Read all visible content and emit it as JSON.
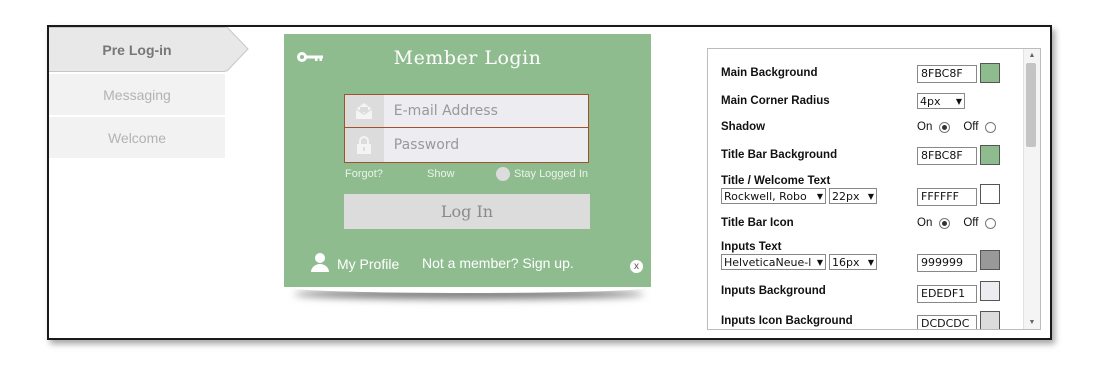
{
  "tabs": [
    {
      "label": "Pre Log-in",
      "active": true
    },
    {
      "label": "Messaging",
      "active": false
    },
    {
      "label": "Welcome",
      "active": false
    }
  ],
  "login": {
    "title": "Member Login",
    "email_placeholder": "E-mail Address",
    "password_placeholder": "Password",
    "forgot": "Forgot?",
    "show": "Show",
    "stay_logged_in": "Stay Logged In",
    "login_button": "Log In",
    "my_profile": "My Profile",
    "signup": "Not a member? Sign up.",
    "close": "x",
    "colors": {
      "background": "#8FBC8F",
      "input_border": "#A0522D",
      "input_bg": "#EDEDF1",
      "icon_bg": "#DCDCDC"
    },
    "icons": [
      "key-icon",
      "envelope-icon",
      "lock-icon",
      "user-icon",
      "close-icon"
    ]
  },
  "settings": {
    "main_background": {
      "label": "Main Background",
      "value": "8FBC8F",
      "color": "#8FBC8F"
    },
    "main_corner_radius": {
      "label": "Main Corner Radius",
      "value": "4px"
    },
    "shadow": {
      "label": "Shadow",
      "on": "On",
      "off": "Off",
      "selected": "On"
    },
    "title_bar_background": {
      "label": "Title Bar Background",
      "value": "8FBC8F",
      "color": "#8FBC8F"
    },
    "title_welcome_text": {
      "label": "Title / Welcome Text",
      "font": "Rockwell, Robo",
      "size": "22px",
      "value": "FFFFFF",
      "color": "#FFFFFF"
    },
    "title_bar_icon": {
      "label": "Title Bar Icon",
      "on": "On",
      "off": "Off",
      "selected": "On"
    },
    "inputs_text": {
      "label": "Inputs Text",
      "font": "HelveticaNeue-l",
      "size": "16px",
      "value": "999999",
      "color": "#999999"
    },
    "inputs_background": {
      "label": "Inputs Background",
      "value": "EDEDF1",
      "color": "#EDEDF1"
    },
    "inputs_icon_background": {
      "label": "Inputs Icon Background",
      "value": "DCDCDC",
      "color": "#DCDCDC"
    }
  }
}
